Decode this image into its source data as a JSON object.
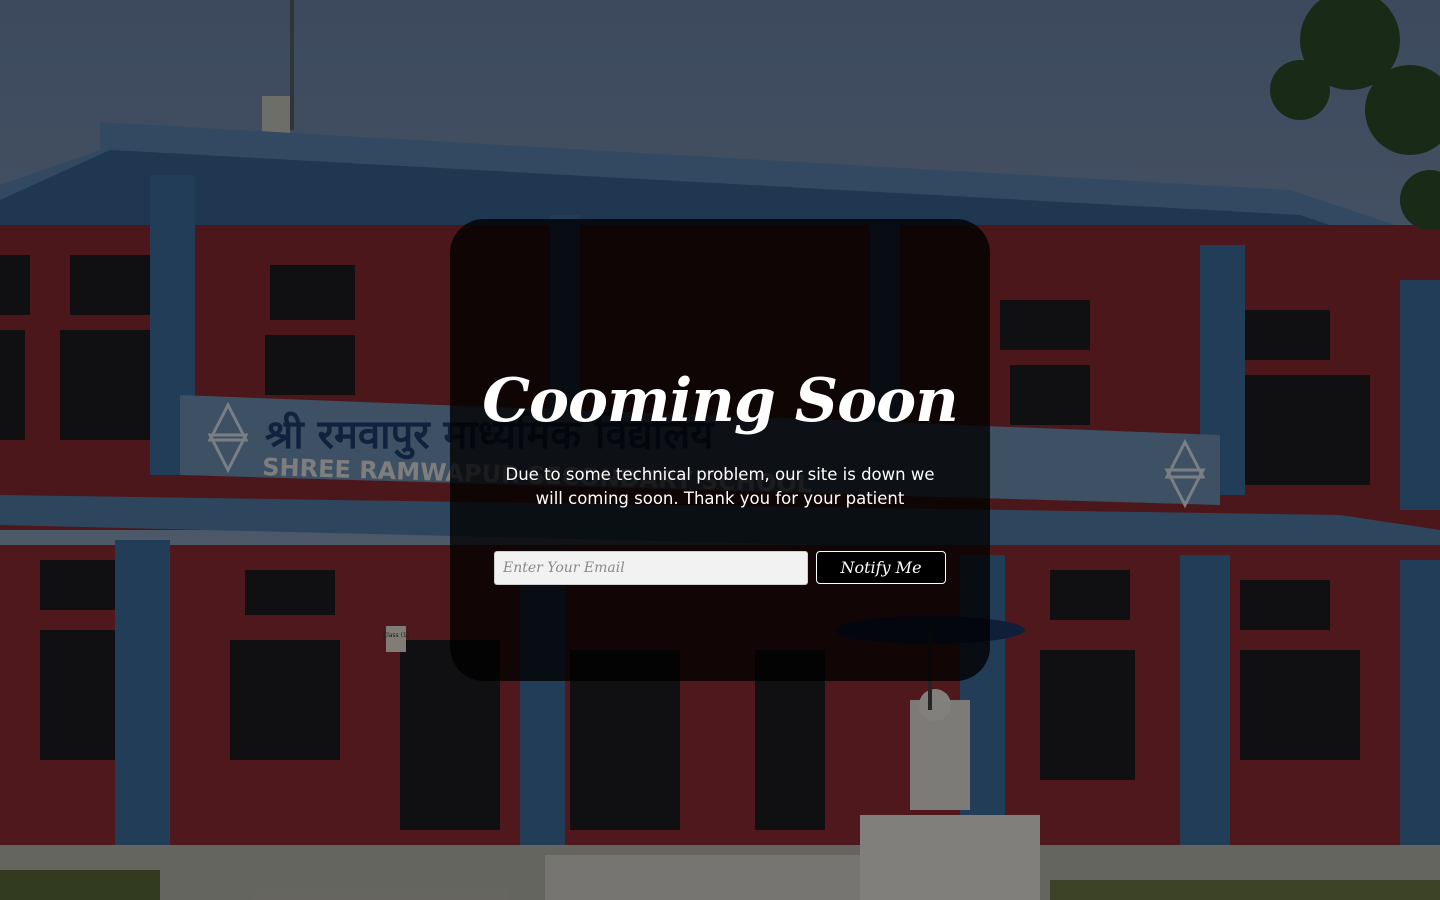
{
  "page": {
    "title": "Cooming Soon",
    "message": "Due to some technical problem, our site is down we will coming soon. Thank you for your patient"
  },
  "form": {
    "email_placeholder": "Enter Your Email",
    "email_value": "",
    "notify_label": "Notify Me"
  },
  "background": {
    "sign_text_nepali": "श्री रमवापुर माध्यमिक विद्यालय",
    "sign_text_english": "SHREE RAMWAPUR SECONDARY SCHOOL",
    "class_plate": "Class (1)"
  },
  "colors": {
    "sky": "#8fa6c4",
    "wall_red": "#a8323a",
    "pillar_blue": "#3f6f9e",
    "card_bg": "#000000",
    "text": "#ffffff"
  }
}
